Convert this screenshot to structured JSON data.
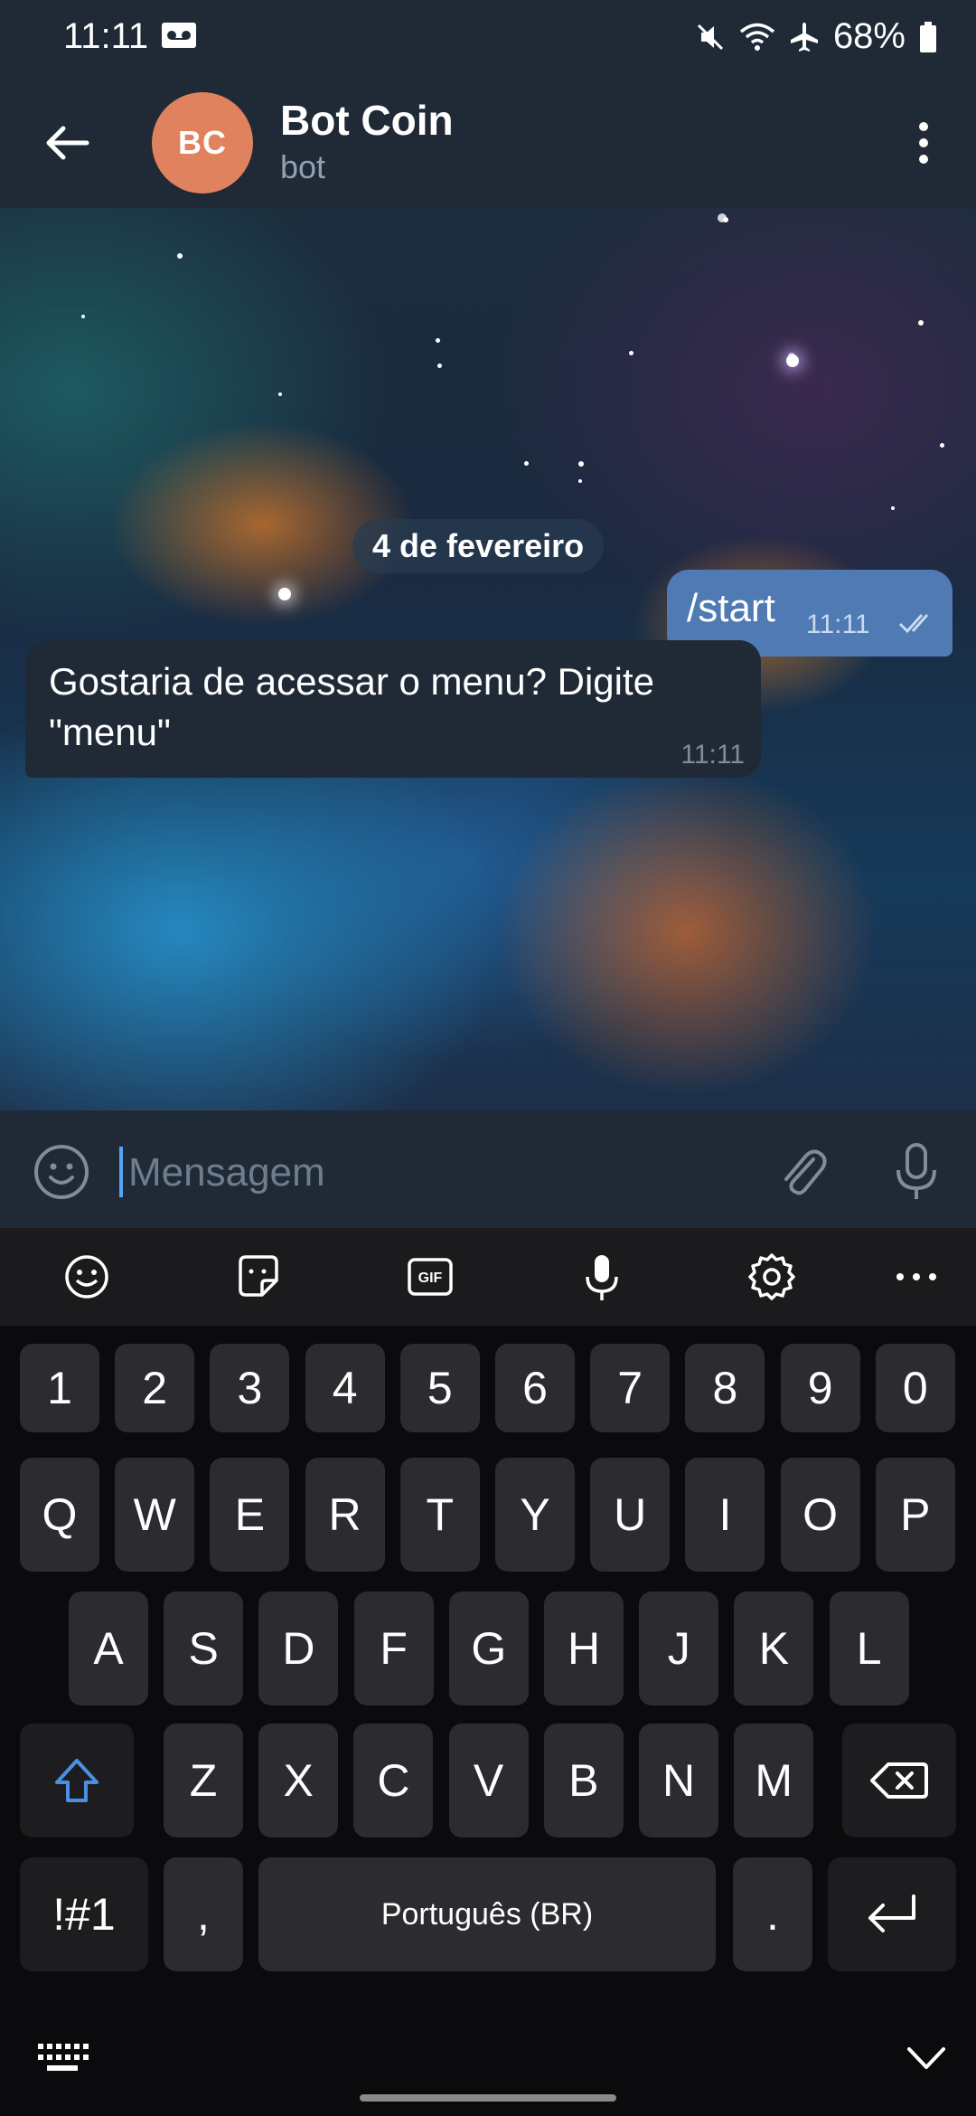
{
  "status_bar": {
    "time": "11:11",
    "battery": "68%",
    "icons": [
      "voicemail-icon",
      "mute-icon",
      "wifi-icon",
      "airplane-icon",
      "battery-icon"
    ]
  },
  "header": {
    "avatar_initials": "BC",
    "avatar_color": "#e1825e",
    "title": "Bot Coin",
    "subtitle": "bot",
    "icons": [
      "back-arrow-icon",
      "more-vertical-icon"
    ]
  },
  "chat": {
    "date_label": "4 de fevereiro",
    "messages": [
      {
        "direction": "outgoing",
        "text": "/start",
        "time": "11:11",
        "status": "read"
      },
      {
        "direction": "incoming",
        "text": "Gostaria de acessar o menu? Digite \"menu\"",
        "time": "11:11"
      }
    ],
    "outgoing_bubble_color": "#4f7ab4",
    "incoming_bubble_color": "#1f2a36"
  },
  "composer": {
    "placeholder": "Mensagem",
    "value": "",
    "icons": [
      "emoji-icon",
      "paperclip-icon",
      "microphone-icon"
    ]
  },
  "keyboard": {
    "toolbar_icons": [
      "emoji-icon",
      "sticker-icon",
      "gif-icon",
      "voice-input-icon",
      "settings-icon",
      "more-horizontal-icon"
    ],
    "gif_label": "GIF",
    "row_numbers": [
      "1",
      "2",
      "3",
      "4",
      "5",
      "6",
      "7",
      "8",
      "9",
      "0"
    ],
    "row1": [
      "Q",
      "W",
      "E",
      "R",
      "T",
      "Y",
      "U",
      "I",
      "O",
      "P"
    ],
    "row2": [
      "A",
      "S",
      "D",
      "F",
      "G",
      "H",
      "J",
      "K",
      "L"
    ],
    "row3": [
      "Z",
      "X",
      "C",
      "V",
      "B",
      "N",
      "M"
    ],
    "symbols_label": "!#1",
    "comma_label": ",",
    "space_label": "Português (BR)",
    "period_label": ".",
    "accent_color": "#4a90e2"
  }
}
